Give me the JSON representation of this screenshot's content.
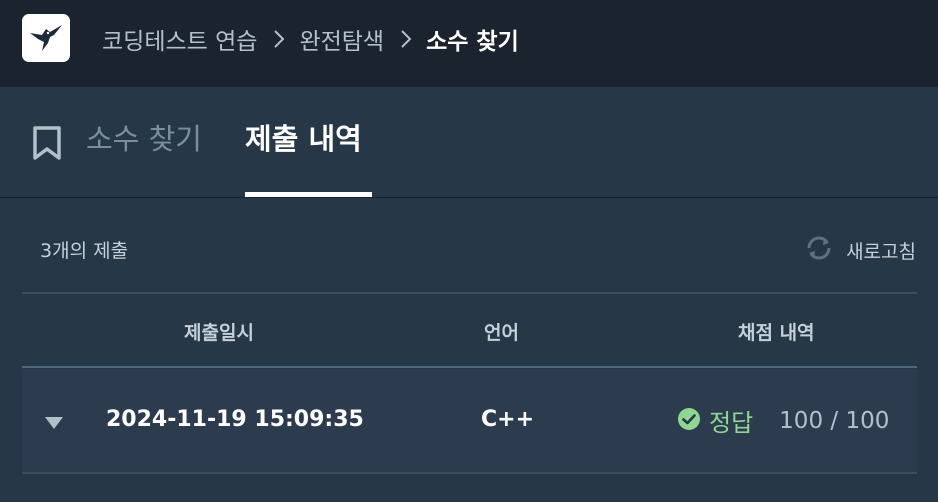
{
  "header": {
    "logo_icon": "hummingbird-logo-icon",
    "breadcrumb": [
      "코딩테스트 연습",
      "완전탐색",
      "소수 찾기"
    ]
  },
  "tabs": {
    "problem_label": "소수 찾기",
    "submissions_label": "제출 내역",
    "active": "submissions"
  },
  "submissions": {
    "count_label": "3개의 제출",
    "refresh_label": "새로고침",
    "columns": [
      "제출일시",
      "언어",
      "채점 내역"
    ],
    "rows": [
      {
        "datetime": "2024-11-19 15:09:35",
        "language": "C++",
        "result": "정답",
        "score": "100 / 100"
      }
    ]
  },
  "colors": {
    "header_bg": "#1b232e",
    "body_bg": "#263747",
    "success": "#8fd694"
  }
}
